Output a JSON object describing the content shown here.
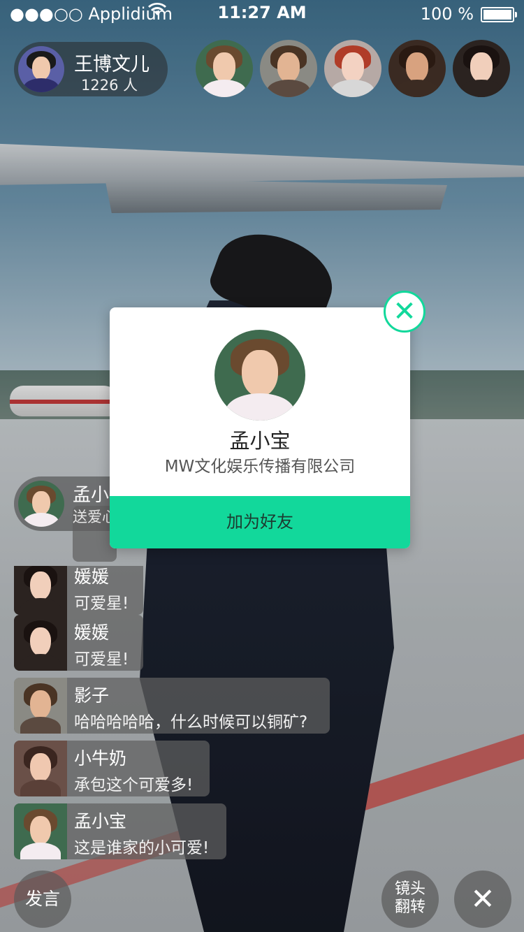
{
  "status_bar": {
    "carrier": "●●●○○ Applidium",
    "wifi_icon": "wifi-icon",
    "time": "11:27 AM",
    "battery": "100 %"
  },
  "host": {
    "name": "王博文儿",
    "viewers": "1226 人"
  },
  "viewers": [
    "viewer-1",
    "viewer-2",
    "viewer-3",
    "viewer-4",
    "viewer-5"
  ],
  "gift_notice": {
    "name": "孟小",
    "message": "送爱心"
  },
  "chat": [
    {
      "user": "媛媛",
      "text": "可爱星!"
    },
    {
      "user": "媛媛",
      "text": "可爱星!"
    },
    {
      "user": "影子",
      "text": "哈哈哈哈哈，什么时候可以铜矿?"
    },
    {
      "user": "小牛奶",
      "text": "承包这个可爱多!"
    },
    {
      "user": "孟小宝",
      "text": "这是谁家的小可爱!"
    }
  ],
  "buttons": {
    "speak": "发言",
    "flip_line1": "镜头",
    "flip_line2": "翻转",
    "close": "✕"
  },
  "profile_popup": {
    "name": "孟小宝",
    "company": "MW文化娱乐传播有限公司",
    "add_friend": "加为好友",
    "close": "✕"
  },
  "colors": {
    "accent": "#12d89b",
    "accent_text": "#1d3a30"
  }
}
